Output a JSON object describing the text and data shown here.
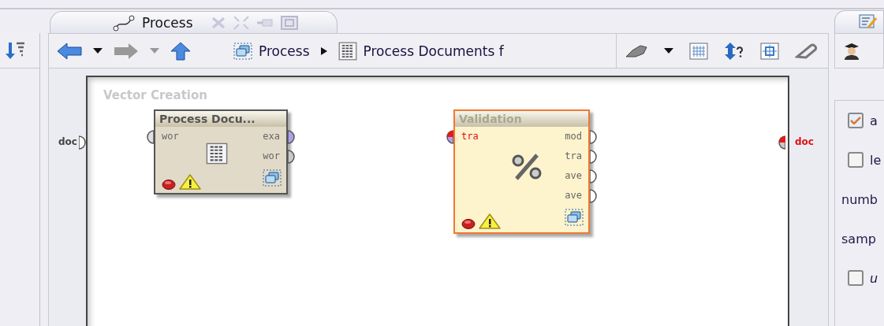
{
  "process_tab": {
    "title": "Process"
  },
  "toolbar": {
    "breadcrumbs": [
      {
        "label": "Process",
        "kind": "process"
      },
      {
        "label": "Process Documents f",
        "kind": "document"
      }
    ]
  },
  "canvas": {
    "title": "Vector Creation",
    "inputs": [
      {
        "label": "doc",
        "color": "#ffffff",
        "error": false
      }
    ],
    "outputs": [
      {
        "label": "doc",
        "color": "#c8c8c8",
        "error": true
      }
    ],
    "operators": [
      {
        "title": "Process Docu...",
        "kind": "document",
        "selected": false,
        "inputs": [
          {
            "label": "wor",
            "color": "#e0e0e0",
            "error": false
          }
        ],
        "outputs": [
          {
            "label": "exa",
            "color": "#b0a0e8",
            "error": false
          },
          {
            "label": "wor",
            "color": "#c8c8c8",
            "error": false
          }
        ]
      },
      {
        "title": "Validation",
        "kind": "percent",
        "selected": true,
        "inputs": [
          {
            "label": "tra",
            "color": "#b0a0e8",
            "error": true
          }
        ],
        "outputs": [
          {
            "label": "mod",
            "color": "#ffffff",
            "error": false
          },
          {
            "label": "tra",
            "color": "#ffffff",
            "error": false
          },
          {
            "label": "ave",
            "color": "#ffffff",
            "error": false
          },
          {
            "label": "ave",
            "color": "#ffffff",
            "error": false
          }
        ]
      }
    ]
  },
  "parameters": {
    "rows": [
      {
        "kind": "checkbox",
        "label": "a",
        "checked": true,
        "italic": false
      },
      {
        "kind": "checkbox",
        "label": "le",
        "checked": false,
        "italic": false
      },
      {
        "kind": "text",
        "label": "numb"
      },
      {
        "kind": "text",
        "label": "samp"
      },
      {
        "kind": "checkbox",
        "label": "u",
        "checked": false,
        "italic": true
      }
    ]
  }
}
